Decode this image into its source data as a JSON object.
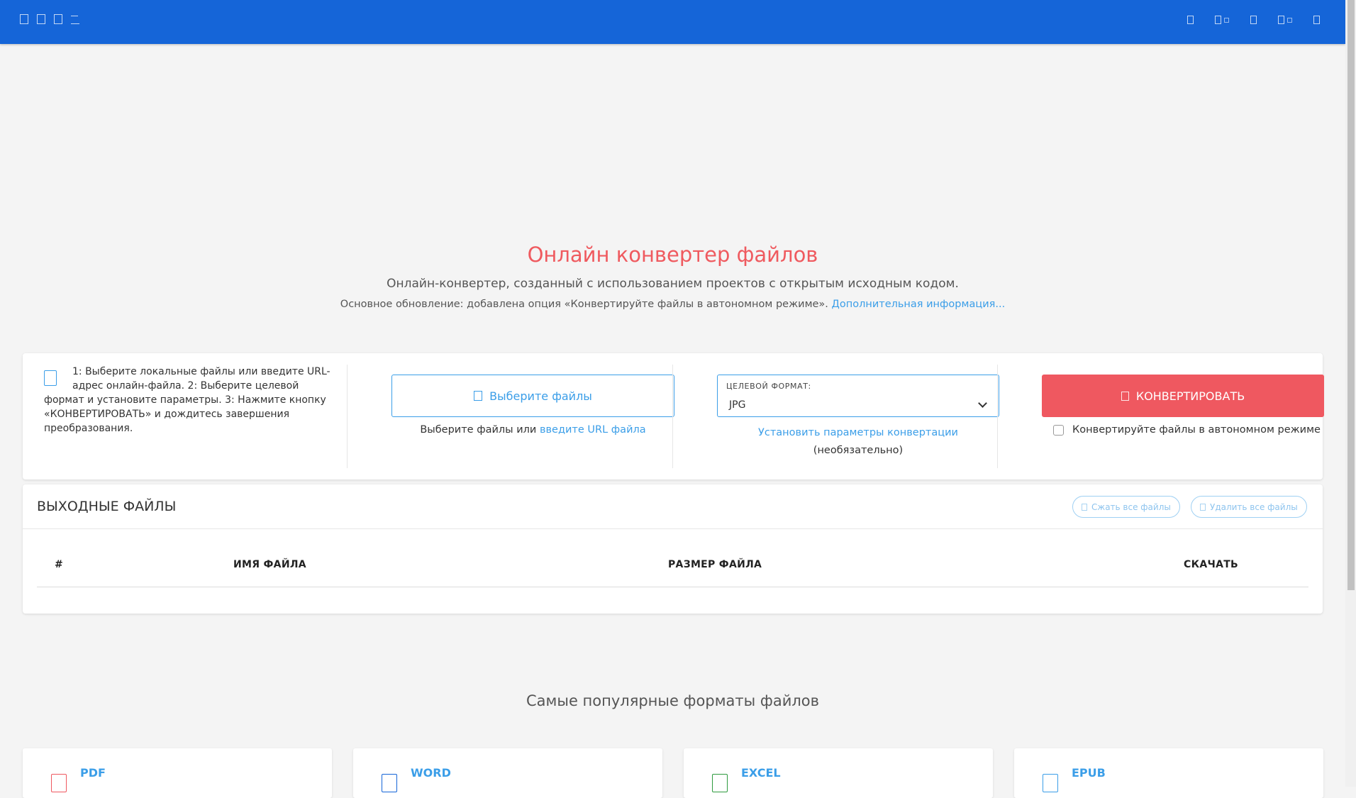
{
  "hero": {
    "title": "Онлайн конвертер файлов",
    "subtitle": "Онлайн-конвертер, созданный с использованием проектов с открытым исходным кодом.",
    "note": "Основное обновление: добавлена опция «Конвертируйте файлы в автономном режиме».",
    "note_link": "Дополнительная информация..."
  },
  "converter": {
    "steps_text": "1: Выберите локальные файлы или введите URL-адрес онлайн-файла. 2: Выберите целевой формат и установите параметры. 3: Нажмите кнопку «КОНВЕРТИРОВАТЬ» и дождитесь завершения преобразования.",
    "choose_files_label": "Выберите файлы",
    "choose_caption": "Выберите файлы или",
    "url_link": "введите URL файла",
    "target_format_label": "ЦЕЛЕВОЙ ФОРМАТ:",
    "target_format_value": "JPG",
    "params_link": "Установить параметры конвертации",
    "params_optional": "(необязательно)",
    "convert_label": "КОНВЕРТИРОВАТЬ",
    "offline_label": "Конвертируйте файлы в автономном режиме"
  },
  "output": {
    "title": "ВЫХОДНЫЕ ФАЙЛЫ",
    "compress_all": "Сжать все файлы",
    "delete_all": "Удалить все файлы",
    "columns": [
      "#",
      "ИМЯ ФАЙЛА",
      "РАЗМЕР ФАЙЛА",
      "СКАЧАТЬ"
    ]
  },
  "popular": {
    "title": "Самые популярные форматы файлов",
    "cards": [
      {
        "name": "PDF",
        "color": "#ef5860"
      },
      {
        "name": "WORD",
        "color": "#1565d8"
      },
      {
        "name": "EXCEL",
        "color": "#2e9b3f"
      },
      {
        "name": "EPUB",
        "color": "#3b9ee8"
      }
    ]
  },
  "colors": {
    "topbar": "#1565d8",
    "accent": "#3b9ee8",
    "danger": "#ef5860"
  }
}
